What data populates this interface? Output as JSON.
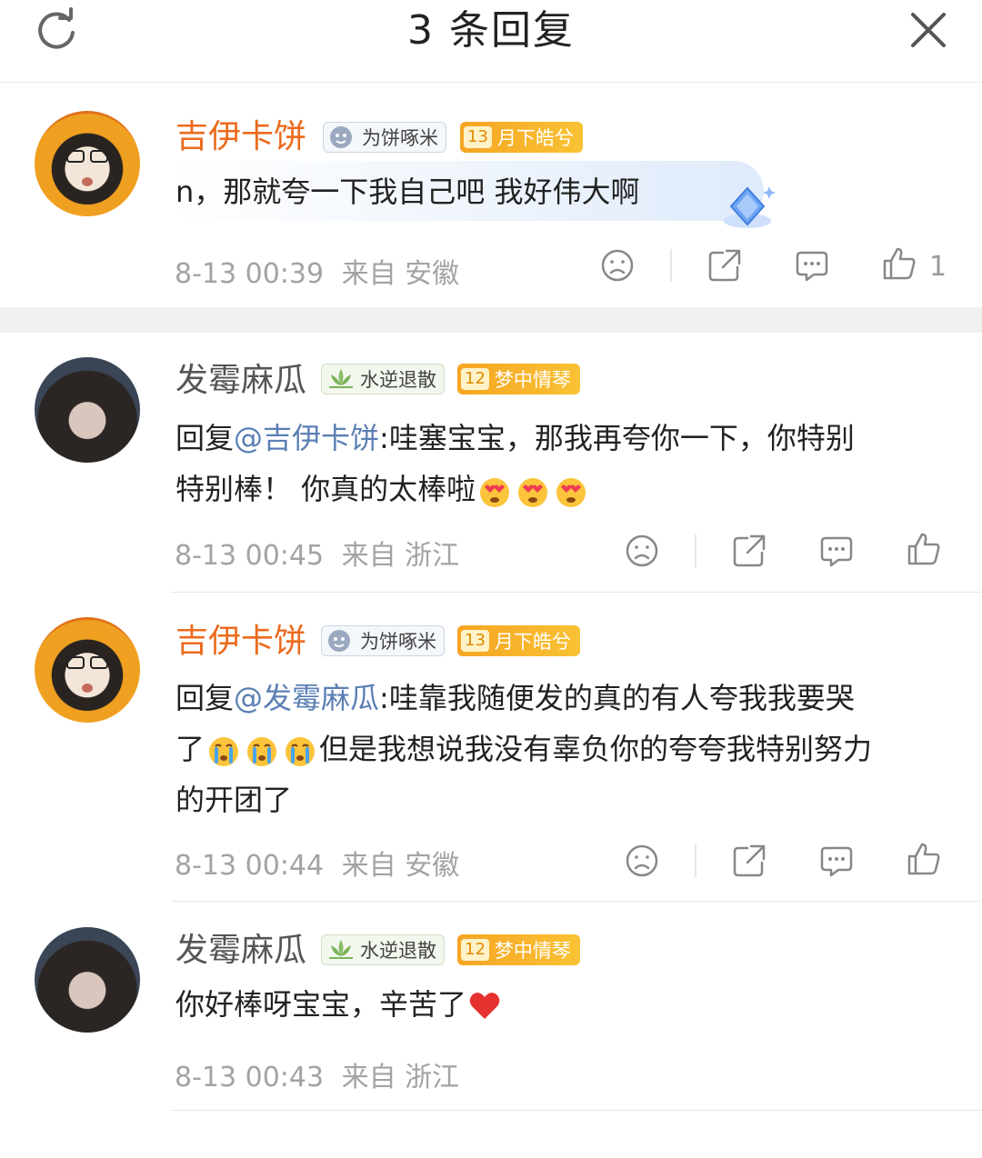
{
  "header": {
    "title": "3 条回复"
  },
  "comments": [
    {
      "name": "吉伊卡饼",
      "fan_badge": "为饼啄米",
      "level_num": "13",
      "level_badge": "月下皓兮",
      "text": "n，那就夸一下我自己吧 我好伟大啊",
      "time": "8-13 00:39",
      "location": "来自 安徽",
      "likes": "1"
    },
    {
      "name": "发霉麻瓜",
      "fan_badge": "水逆退散",
      "level_num": "12",
      "level_badge": "梦中情琴",
      "reply_prefix": "回复",
      "mention": "@吉伊卡饼",
      "text_line1": ":哇塞宝宝，那我再夸你一下，你特别",
      "text_line2": "特别棒！ 你真的太棒啦",
      "time": "8-13 00:45",
      "location": "来自 浙江"
    },
    {
      "name": "吉伊卡饼",
      "fan_badge": "为饼啄米",
      "level_num": "13",
      "level_badge": "月下皓兮",
      "reply_prefix": "回复",
      "mention": "@发霉麻瓜",
      "text_line1": ":哇靠我随便发的真的有人夸我我要哭",
      "text_line2_a": "了",
      "text_line2_b": "但是我想说我没有辜负你的夸夸我特别努力",
      "text_line3": "的开团了",
      "time": "8-13 00:44",
      "location": "来自 安徽"
    },
    {
      "name": "发霉麻瓜",
      "fan_badge": "水逆退散",
      "level_num": "12",
      "level_badge": "梦中情琴",
      "text": "你好棒呀宝宝，辛苦了",
      "time": "8-13 00:43",
      "location": "来自 浙江"
    }
  ],
  "colors": {
    "name_orange": "#ec6a1c",
    "name_gray": "#555555",
    "mention": "#5b7fb4",
    "meta": "#a3a3a3",
    "badge_gold": "#f6a523"
  },
  "icons": [
    "refresh-icon",
    "close-icon",
    "dislike-icon",
    "share-icon",
    "comment-icon",
    "like-icon"
  ]
}
